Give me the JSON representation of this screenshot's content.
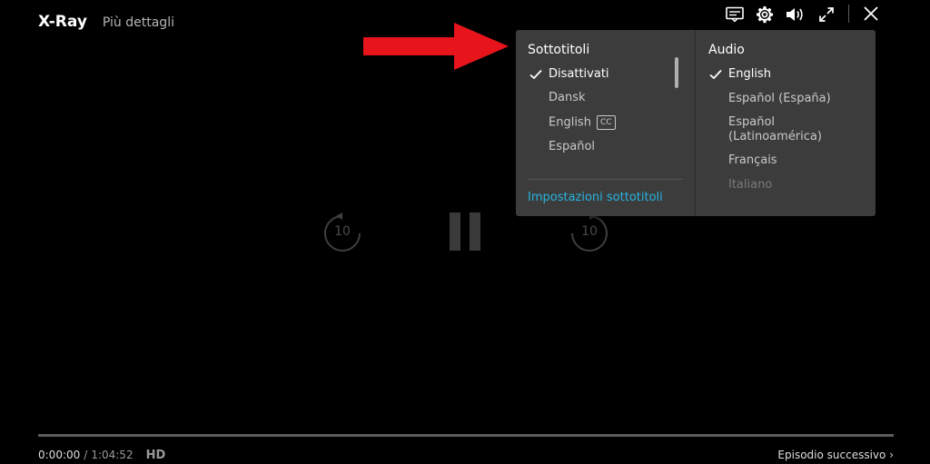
{
  "header": {
    "xray_label": "X-Ray",
    "more_details_label": "Più dettagli"
  },
  "top_icons": [
    "subtitles-icon",
    "gear-icon",
    "volume-icon",
    "fullscreen-icon",
    "close-icon"
  ],
  "controls": {
    "rewind_label": "10",
    "forward_label": "10"
  },
  "subtitles_menu": {
    "title": "Sottotitoli",
    "options": [
      {
        "label": "Disattivati",
        "selected": true
      },
      {
        "label": "Dansk",
        "selected": false
      },
      {
        "label": "English",
        "selected": false,
        "badge": "CC"
      },
      {
        "label": "Español",
        "selected": false
      }
    ],
    "settings_link": "Impostazioni sottotitoli"
  },
  "audio_menu": {
    "title": "Audio",
    "options": [
      {
        "label": "English",
        "selected": true
      },
      {
        "label": "Español (España)",
        "selected": false
      },
      {
        "label": "Español\n(Latinoamérica)",
        "selected": false
      },
      {
        "label": "Français",
        "selected": false
      },
      {
        "label": "Italiano",
        "selected": false
      }
    ]
  },
  "playback": {
    "current_time": "0:00:00",
    "separator": "/",
    "total_time": "1:04:52",
    "quality": "HD",
    "progress": 0.0,
    "next_episode": "Episodio successivo ›"
  },
  "colors": {
    "accent_link": "#27b5e0",
    "arrow": "#e8141c",
    "menu_bg": "#3c3c3c"
  }
}
